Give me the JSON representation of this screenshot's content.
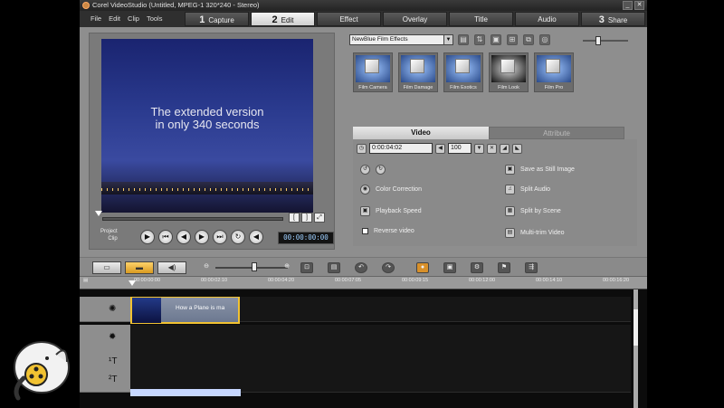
{
  "window": {
    "title": "Corel VideoStudio (Untitled, MPEG-1 320*240 - Stereo)"
  },
  "menu": [
    "File",
    "Edit",
    "Clip",
    "Tools"
  ],
  "steps": [
    {
      "num": "1",
      "label": "Capture",
      "active": false
    },
    {
      "num": "2",
      "label": "Edit",
      "active": true
    },
    {
      "num": "",
      "label": "Effect",
      "active": false
    },
    {
      "num": "",
      "label": "Overlay",
      "active": false
    },
    {
      "num": "",
      "label": "Title",
      "active": false
    },
    {
      "num": "",
      "label": "Audio",
      "active": false
    },
    {
      "num": "3",
      "label": "Share",
      "active": false
    }
  ],
  "preview": {
    "overlay_text_line1": "The extended version",
    "overlay_text_line2": "in only 340 seconds",
    "project_label": "Project",
    "clip_label": "Clip",
    "timecode": "00:00:00:00"
  },
  "library": {
    "selected_category": "NewBlue Film Effects",
    "effects": [
      "Film Camera",
      "Film Damage",
      "Film Exotics",
      "Film Look",
      "Film Pro"
    ]
  },
  "tabs": {
    "video": "Video",
    "attribute": "Attribute"
  },
  "options": {
    "duration": "0:00:04:02",
    "volume": "100",
    "color_correction": "Color Correction",
    "playback_speed": "Playback Speed",
    "reverse_video": "Reverse video",
    "save_still": "Save as Still Image",
    "split_audio": "Split Audio",
    "split_by_scene": "Split by Scene",
    "multi_trim": "Multi-trim Video"
  },
  "ruler_ticks": [
    "00:00:00:00",
    "00:00:02:10",
    "00:00:04:20",
    "00:00:07:05",
    "00:00:09:15",
    "00:00:12:00",
    "00:00:14:10",
    "00:00:16:20"
  ],
  "timeline": {
    "clip_title": "How a Plane is ma"
  }
}
